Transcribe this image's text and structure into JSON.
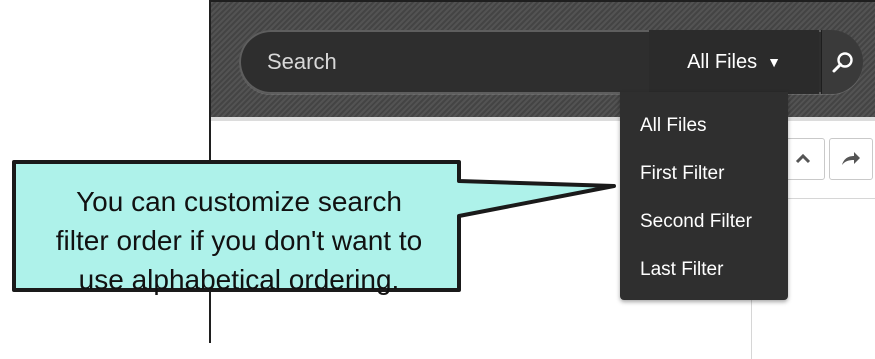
{
  "search": {
    "placeholder": "Search",
    "scope_label": "All Files",
    "scope_arrow": "▼",
    "search_icon": "magnifier-icon"
  },
  "dropdown": {
    "items": [
      {
        "label": "All Files"
      },
      {
        "label": "First Filter"
      },
      {
        "label": "Second Filter"
      },
      {
        "label": "Last Filter"
      }
    ]
  },
  "toolbar": {
    "icons": [
      "arrow-up-icon",
      "share-arrow-icon"
    ]
  },
  "callout": {
    "lines": [
      "You can customize search",
      "filter order if you don't want to",
      "use alphabetical ordering."
    ],
    "fill_color": "#aef2ea",
    "border_color": "#1a1a1a"
  },
  "colors": {
    "header_bg": "#4a4a4a",
    "dropdown_bg": "#2f2f2f"
  }
}
